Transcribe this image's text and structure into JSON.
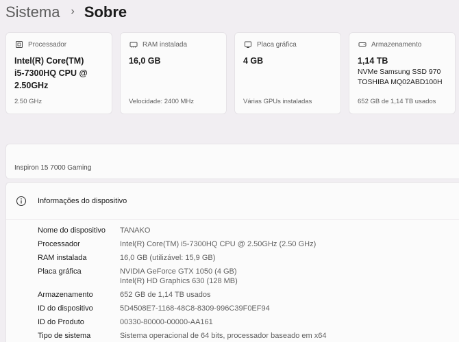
{
  "breadcrumb": {
    "parent": "Sistema",
    "separator": "›",
    "current": "Sobre"
  },
  "cards": [
    {
      "icon": "processor-icon",
      "title": "Processador",
      "value_lines": [
        "Intel(R) Core(TM)",
        "i5-7300HQ CPU @",
        "2.50GHz"
      ],
      "footer": "2.50 GHz"
    },
    {
      "icon": "ram-icon",
      "title": "RAM instalada",
      "value_lines": [
        "16,0 GB"
      ],
      "footer": "Velocidade: 2400 MHz"
    },
    {
      "icon": "graphics-card-icon",
      "title": "Placa gráfica",
      "value_lines": [
        "4 GB"
      ],
      "footer": "Várias GPUs instaladas"
    },
    {
      "icon": "storage-icon",
      "title": "Armazenamento",
      "value": "1,14 TB",
      "sub_lines": [
        "NVMe Samsung SSD 970",
        "TOSHIBA MQ02ABD100H"
      ],
      "footer": "652 GB de 1,14 TB usados"
    }
  ],
  "model": "Inspiron 15 7000 Gaming",
  "info": {
    "title": "Informações do dispositivo",
    "rows": [
      {
        "label": "Nome do dispositivo",
        "values": [
          "TANAKO"
        ]
      },
      {
        "label": "Processador",
        "values": [
          "Intel(R) Core(TM) i5-7300HQ CPU @ 2.50GHz (2.50 GHz)"
        ]
      },
      {
        "label": "RAM instalada",
        "values": [
          "16,0 GB (utilizável: 15,9 GB)"
        ]
      },
      {
        "label": "Placa gráfica",
        "values": [
          "NVIDIA GeForce GTX 1050 (4 GB)",
          "Intel(R) HD Graphics 630 (128 MB)"
        ]
      },
      {
        "label": "Armazenamento",
        "values": [
          "652 GB de 1,14 TB usados"
        ]
      },
      {
        "label": "ID do dispositivo",
        "values": [
          "5D4508E7-1168-48C8-8309-996C39F0EF94"
        ]
      },
      {
        "label": "ID do Produto",
        "values": [
          "00330-80000-00000-AA161"
        ]
      },
      {
        "label": "Tipo de sistema",
        "values": [
          "Sistema operacional de 64 bits, processador baseado em x64"
        ]
      }
    ]
  }
}
